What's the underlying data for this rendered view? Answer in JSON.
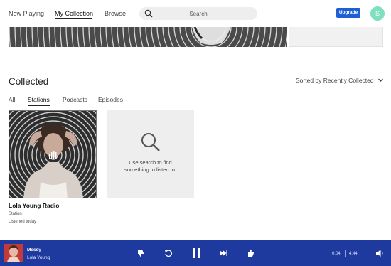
{
  "nav": {
    "now_playing": "Now Playing",
    "my_collection": "My Collection",
    "browse": "Browse",
    "search_placeholder": "Search",
    "upgrade": "Upgrade",
    "avatar_initial": "S"
  },
  "collected": {
    "title": "Collected",
    "sort_label": "Sorted by Recently Collected",
    "tabs": [
      {
        "label": "All",
        "active": false
      },
      {
        "label": "Stations",
        "active": true
      },
      {
        "label": "Podcasts",
        "active": false
      },
      {
        "label": "Episodes",
        "active": false
      }
    ],
    "station_card": {
      "title": "Lola Young Radio",
      "type": "Station",
      "listened": "Listened today"
    },
    "empty_card": {
      "line1": "Use search to find",
      "line2": "something to listen to."
    }
  },
  "player": {
    "title": "Messy",
    "artist": "Lola Young",
    "elapsed": "0:04",
    "duration": "4:44",
    "accent": "#1f3a9e"
  }
}
